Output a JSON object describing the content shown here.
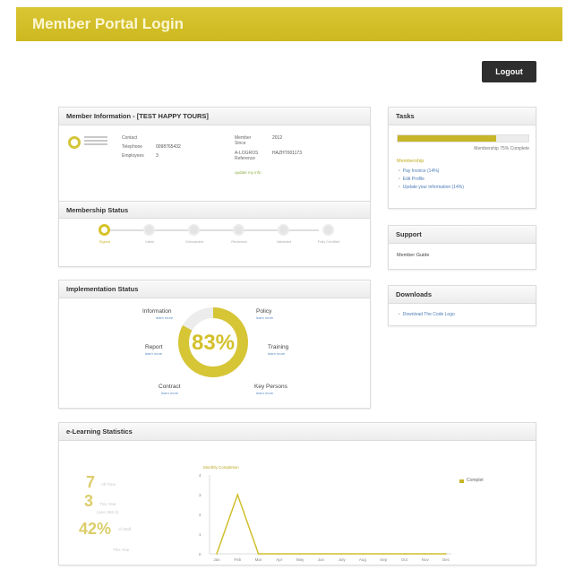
{
  "header": {
    "title": "Member Portal Login"
  },
  "logout_label": "Logout",
  "member_info": {
    "title": "Member Information - [TEST HAPPY TOURS]",
    "contact_label": "Contact",
    "telephone_label": "Telephone",
    "telephone_value": "0098765432",
    "employees_label": "Employees",
    "employees_value": "3",
    "member_since_label": "Member Since",
    "member_since_value": "2012",
    "reference_label": "A-LOGROS Reference",
    "reference_value": "HAZHT001173",
    "edit_link": "update my info"
  },
  "membership": {
    "title": "Membership Status",
    "steps": [
      {
        "label": "Signed",
        "active": true
      },
      {
        "label": "Initial",
        "active": false
      },
      {
        "label": "Onboarded",
        "active": false
      },
      {
        "label": "Reviewed",
        "active": false
      },
      {
        "label": "Validated",
        "active": false
      },
      {
        "label": "Fully Certified",
        "active": false
      }
    ]
  },
  "implementation": {
    "title": "Implementation Status",
    "percent": "83%",
    "percent_value": 83,
    "items": {
      "information": "Information",
      "policy": "Policy",
      "report": "Report",
      "training": "Training",
      "contract": "Contract",
      "key_persons": "Key Persons"
    },
    "learn_more": "learn more"
  },
  "tasks": {
    "title": "Tasks",
    "progress_value": 0.75,
    "progress_caption": "Membership 75% Complete",
    "section": "Membership",
    "items": [
      "Pay Invoice (14%)",
      "Edit Profile",
      "Update your information (14%)"
    ]
  },
  "support": {
    "title": "Support",
    "text": "Member Guide"
  },
  "downloads": {
    "title": "Downloads",
    "items": [
      "Download The Code Logo"
    ]
  },
  "elearning": {
    "title": "e-Learning Statistics",
    "stat1_num": "7",
    "stat1_label": "All Time",
    "stat2_num": "3",
    "stat2_label": "This Year",
    "stat2_sub": "(over 365 3)",
    "stat3_num": "42%",
    "stat3_label": "of Staff",
    "stat3_sub": "This Year",
    "chart_title": "Monthly Completion",
    "legend": "Complet"
  },
  "chart_data": {
    "type": "line",
    "title": "Monthly Completion",
    "categories": [
      "Jan",
      "Feb",
      "Mar",
      "Apr",
      "May",
      "Jun",
      "July",
      "Aug",
      "Sep",
      "Oct",
      "Nov",
      "Dec"
    ],
    "series": [
      {
        "name": "Complet",
        "values": [
          0,
          3,
          0,
          0,
          0,
          0,
          0,
          0,
          0,
          0,
          0,
          0
        ]
      }
    ],
    "ylim": [
      0,
      4
    ],
    "yticks": [
      "0",
      "1",
      "2",
      "3",
      "4"
    ],
    "legend_position": "top-right",
    "grid": false
  },
  "colors": {
    "accent": "#d4c12b",
    "header": "#cdb820",
    "link": "#4b7ab5"
  }
}
